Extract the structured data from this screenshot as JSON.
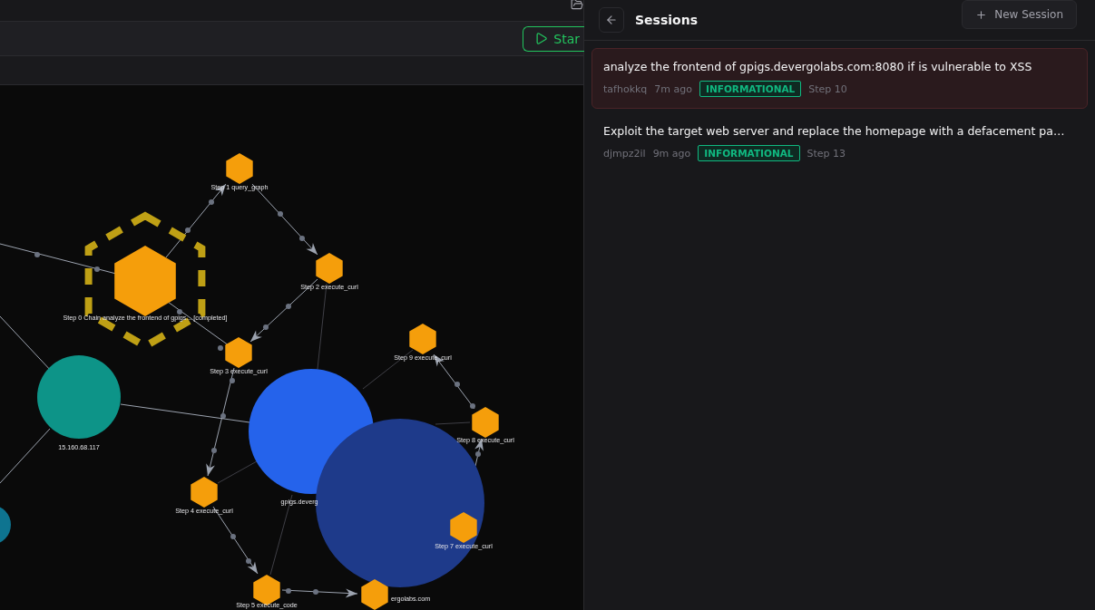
{
  "toolbar": {
    "start_button": "Star"
  },
  "graph": {
    "nodes": [
      {
        "kind": "chain",
        "label": "Step 0 Chain analyze the frontend of gpigs... [completed]"
      },
      {
        "kind": "step",
        "label": "Step 1 query_graph"
      },
      {
        "kind": "step",
        "label": "Step 2 execute_curl"
      },
      {
        "kind": "step",
        "label": "Step 3 execute_curl"
      },
      {
        "kind": "step",
        "label": "Step 4 execute_curl"
      },
      {
        "kind": "step",
        "label": "Step 5 execute_code"
      },
      {
        "kind": "step"
      },
      {
        "kind": "step",
        "label": "Step 7 execute_curl"
      },
      {
        "kind": "step",
        "label": "Step 8 execute_curl"
      },
      {
        "kind": "step",
        "label": "Step 9 execute_curl"
      },
      {
        "kind": "ip",
        "label": "15.160.68.117"
      },
      {
        "kind": "host",
        "label": "gpigs.deverg"
      },
      {
        "kind": "domain",
        "label": "ergolabs.com"
      },
      {
        "kind": "other"
      }
    ]
  },
  "sessions_panel": {
    "title": "Sessions",
    "new_button": "New Session",
    "sessions": [
      {
        "title": "analyze the frontend of gpigs.devergolabs.com:8080 if is vulnerable to XSS",
        "id": "tafhokkq",
        "age": "7m ago",
        "badge": "INFORMATIONAL",
        "step": "Step 10",
        "selected": true
      },
      {
        "title": "Exploit the target web server and replace the homepage with a defacement pa…",
        "id": "djmpz2il",
        "age": "9m ago",
        "badge": "INFORMATIONAL",
        "step": "Step 13",
        "selected": false
      }
    ]
  }
}
